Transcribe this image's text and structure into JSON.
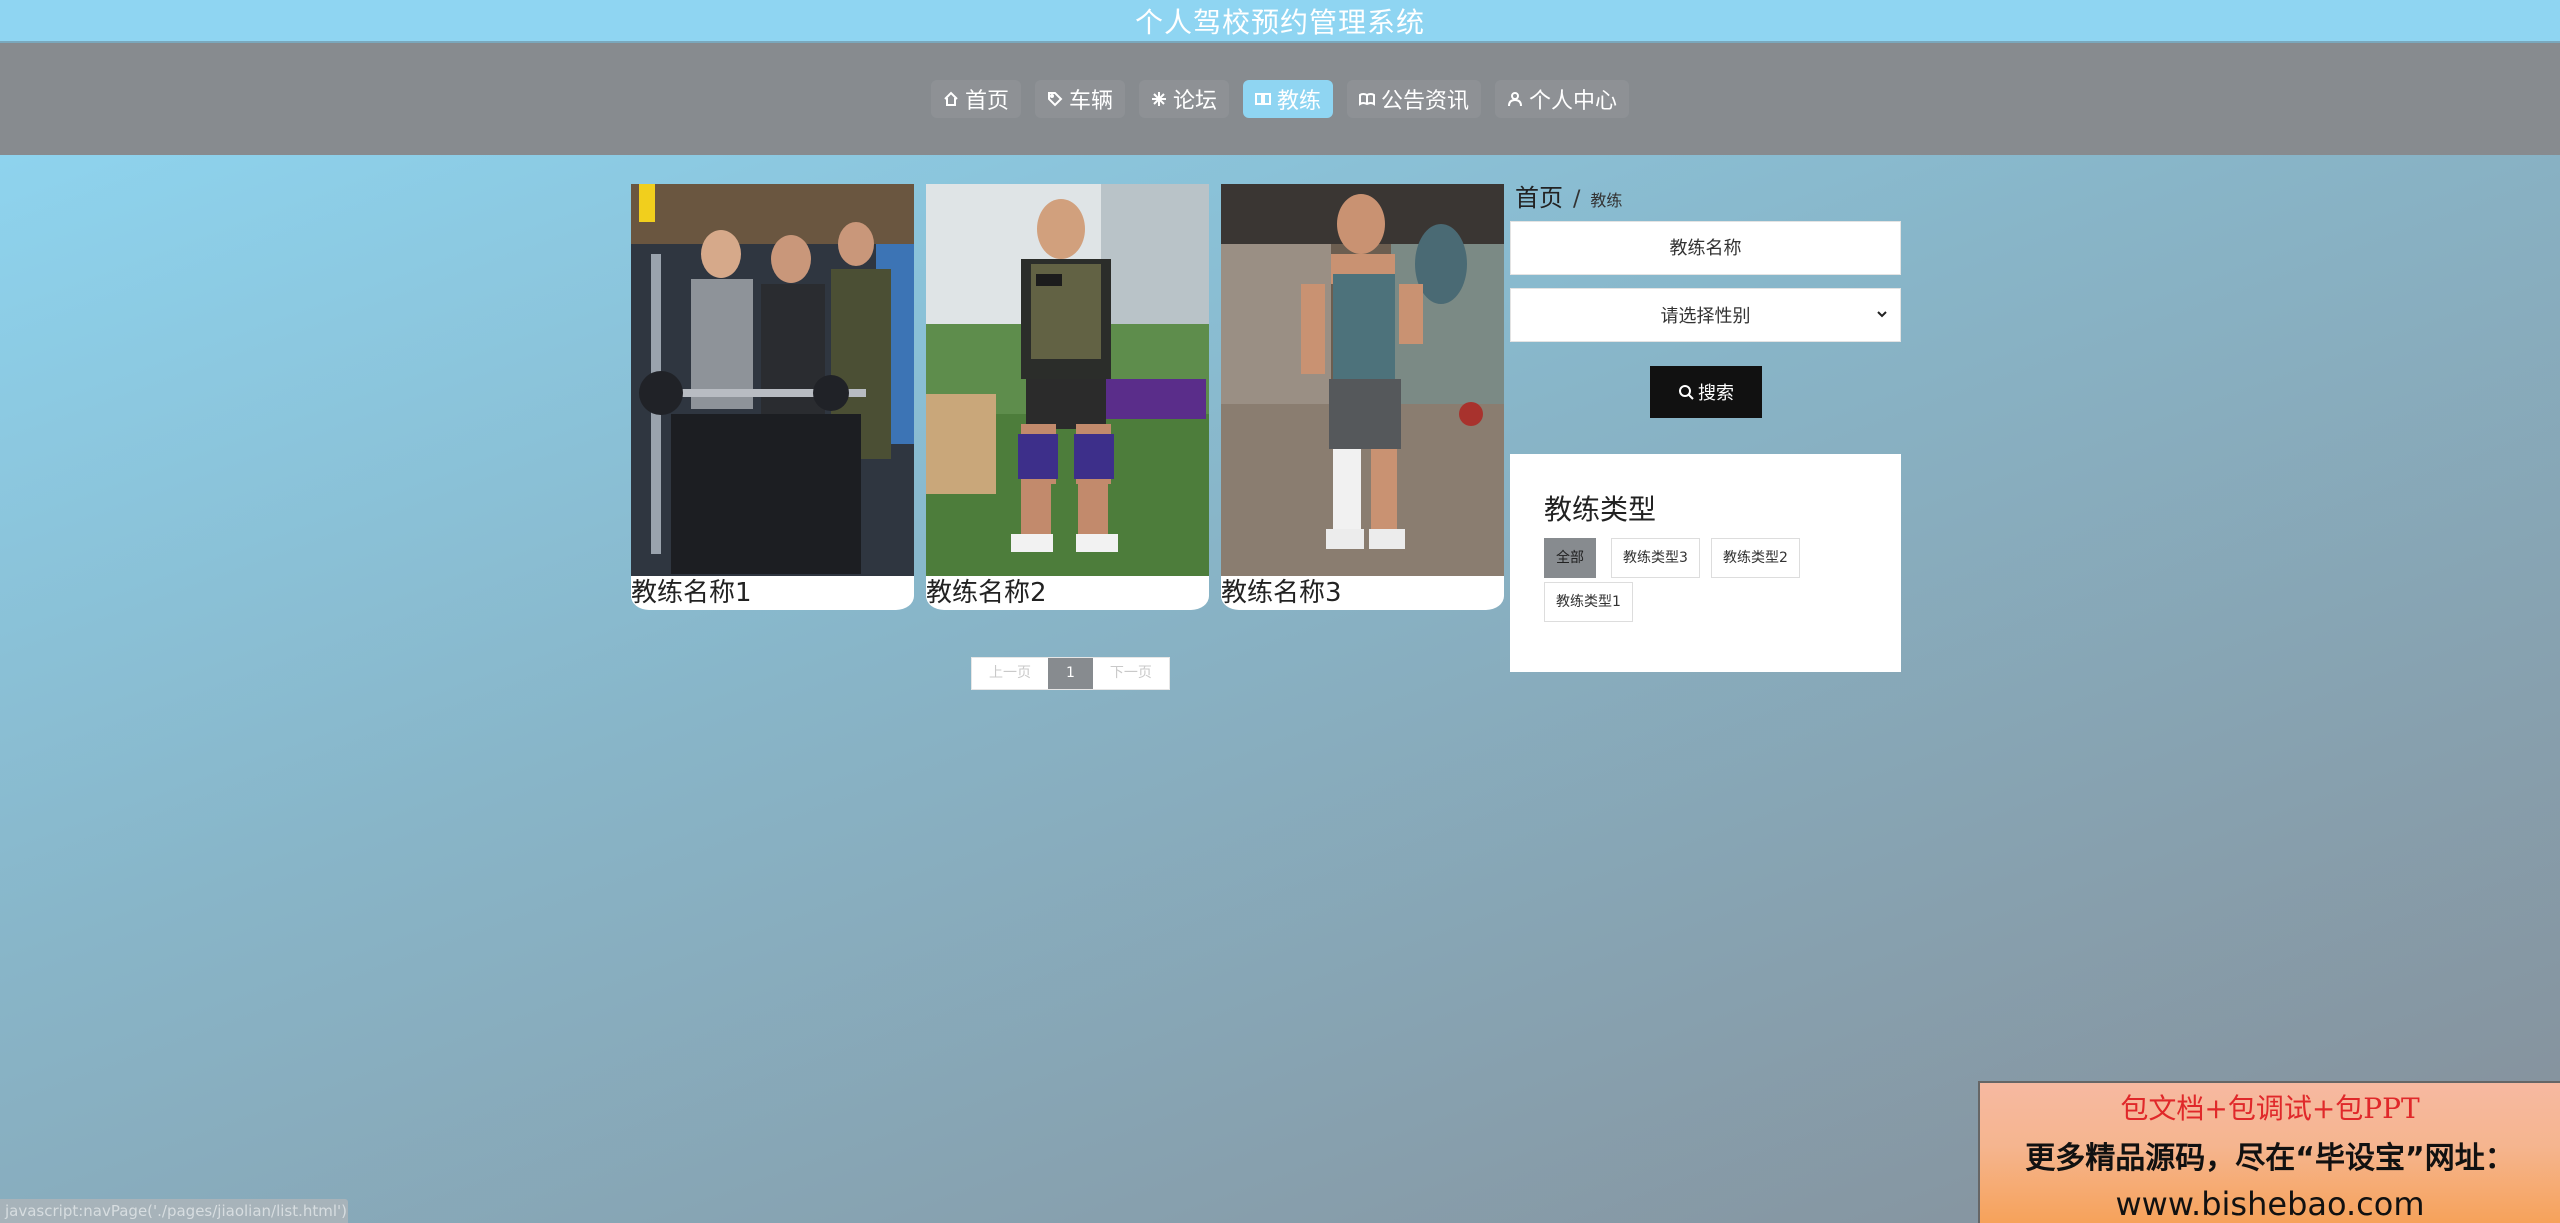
{
  "site": {
    "title": "个人驾校预约管理系统"
  },
  "nav": {
    "items": [
      {
        "label": "首页",
        "icon": "home-icon"
      },
      {
        "label": "车辆",
        "icon": "tag-icon"
      },
      {
        "label": "论坛",
        "icon": "snowflake-icon"
      },
      {
        "label": "教练",
        "icon": "book-icon",
        "active": true
      },
      {
        "label": "公告资讯",
        "icon": "open-book-icon"
      },
      {
        "label": "个人中心",
        "icon": "user-icon"
      }
    ]
  },
  "coaches": [
    {
      "name": "教练名称1"
    },
    {
      "name": "教练名称2"
    },
    {
      "name": "教练名称3"
    }
  ],
  "pagination": {
    "prev": "上一页",
    "current": "1",
    "next": "下一页"
  },
  "breadcrumb": {
    "home": "首页",
    "separator": "/",
    "current": "教练"
  },
  "search": {
    "name_placeholder": "教练名称",
    "gender_select": "请选择性别",
    "button_label": "搜索"
  },
  "types": {
    "title": "教练类型",
    "tags": [
      "全部",
      "教练类型3",
      "教练类型2",
      "教练类型1"
    ],
    "active": "全部"
  },
  "promo": {
    "line1": "包文档+包调试+包PPT",
    "line2": "更多精品源码，尽在“毕设宝”网址：",
    "line3": "www.bishebao.com"
  },
  "status_url": "javascript:navPage('./pages/jiaolian/list.html')",
  "colors": {
    "accent": "#8fd5f2",
    "navbar": "#878b8f",
    "button": "#111111"
  }
}
